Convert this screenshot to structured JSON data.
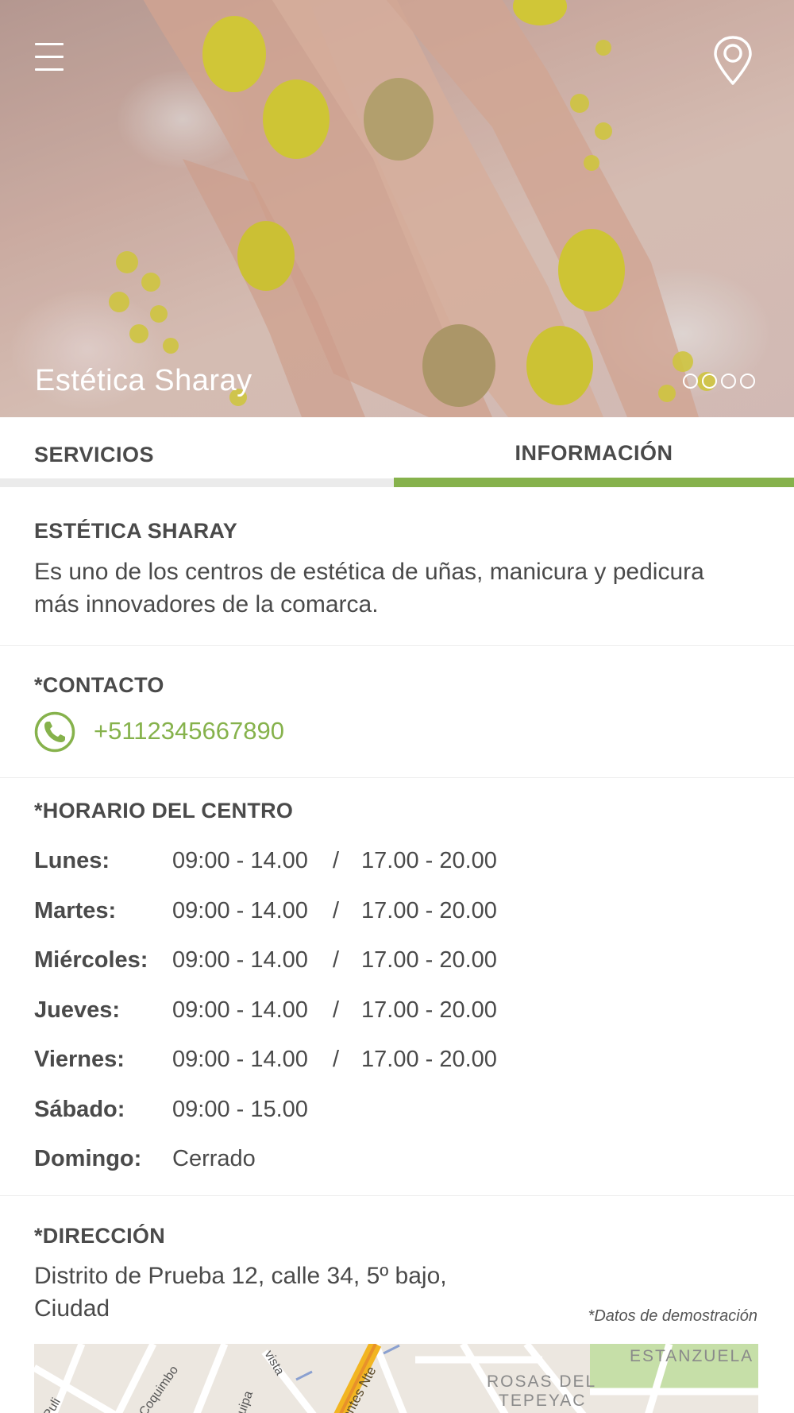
{
  "hero": {
    "title": "Estética Sharay",
    "menu_icon": "hamburger-menu-icon",
    "location_icon": "map-pin-icon",
    "carousel_dots": 4
  },
  "tabs": [
    {
      "label": "SERVICIOS",
      "active": false
    },
    {
      "label": "INFORMACIÓN",
      "active": true
    }
  ],
  "colors": {
    "accent": "#86b24c",
    "text": "#4a4a4a",
    "inactive_tab_bar": "#ebebeb"
  },
  "about": {
    "title": "ESTÉTICA SHARAY",
    "description": "Es uno de los centros de estética de uñas, manicura y pedicura más innovadores de la comarca."
  },
  "contact": {
    "title": "*CONTACTO",
    "phone_icon": "phone-icon",
    "phone": "+5112345667890"
  },
  "hours": {
    "title": "*HORARIO DEL CENTRO",
    "rows": [
      {
        "day": "Lunes:",
        "morning": "09:00 - 14.00",
        "sep": "/",
        "afternoon": "17.00 - 20.00"
      },
      {
        "day": "Martes:",
        "morning": "09:00 - 14.00",
        "sep": "/",
        "afternoon": "17.00 - 20.00"
      },
      {
        "day": "Miércoles:",
        "morning": "09:00 - 14.00",
        "sep": "/",
        "afternoon": "17.00 - 20.00"
      },
      {
        "day": "Jueves:",
        "morning": "09:00 - 14.00",
        "sep": "/",
        "afternoon": "17.00 - 20.00"
      },
      {
        "day": "Viernes:",
        "morning": "09:00 - 14.00",
        "sep": "/",
        "afternoon": "17.00 - 20.00"
      },
      {
        "day": "Sábado:",
        "morning": "09:00 - 15.00",
        "sep": "",
        "afternoon": ""
      },
      {
        "day": "Domingo:",
        "morning": "Cerrado",
        "sep": "",
        "afternoon": ""
      }
    ]
  },
  "address": {
    "title": "*DIRECCIÓN",
    "text": "Distrito de Prueba 12, calle 34, 5º bajo, Ciudad",
    "demo_note": "*Datos de demostración",
    "map_labels": [
      "Coquimbo",
      "ESTANZUELA",
      "ROSAS DEL",
      "TEPEYAC",
      "vista",
      "uipa",
      "ientes Nte"
    ]
  }
}
